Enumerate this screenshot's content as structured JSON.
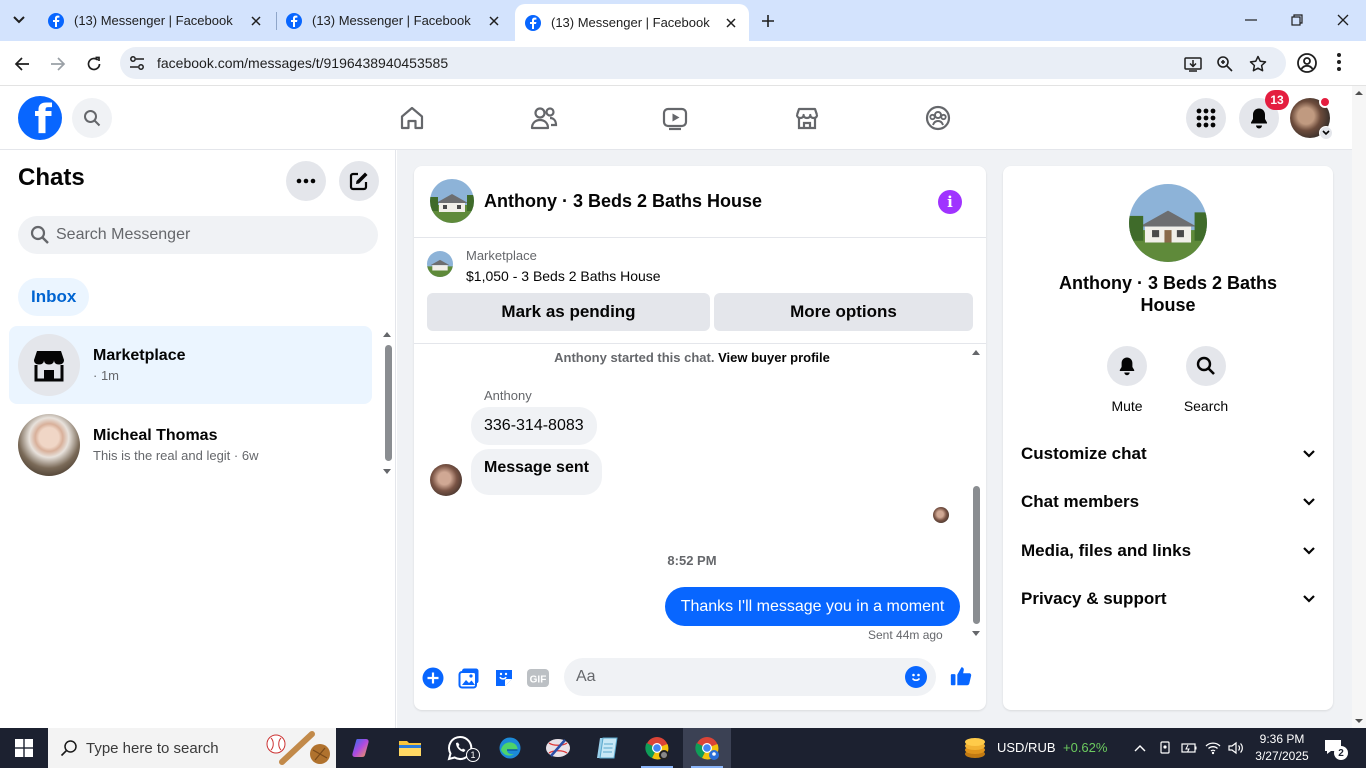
{
  "browser": {
    "tabs": [
      {
        "title": "(13) Messenger | Facebook"
      },
      {
        "title": "(13) Messenger | Facebook"
      },
      {
        "title": "(13) Messenger | Facebook"
      }
    ],
    "url": "facebook.com/messages/t/9196438940453585"
  },
  "fb_header": {
    "notification_count": "13",
    "brand_color": "#0866ff"
  },
  "left": {
    "title": "Chats",
    "search_placeholder": "Search Messenger",
    "inbox_label": "Inbox",
    "conversations": [
      {
        "name": "Marketplace",
        "preview": "· 1m"
      },
      {
        "name": "Micheal Thomas",
        "preview": "This is the real and legit · 6w"
      }
    ]
  },
  "conversation": {
    "title": "Anthony · 3 Beds 2 Baths House",
    "marketplace_label": "Marketplace",
    "listing": "$1,050 - 3 Beds 2 Baths House",
    "mark_pending": "Mark as pending",
    "more_options": "More options",
    "started_text": "Anthony started this chat.",
    "view_profile": "View buyer profile",
    "sender_name": "Anthony",
    "incoming": [
      "336-314-8083",
      "Message sent"
    ],
    "time_separator": "8:52 PM",
    "outgoing": "Thanks I'll message you in a moment",
    "sent_status": "Sent 44m ago",
    "composer_placeholder": "Aa",
    "gif_label": "GIF"
  },
  "info_panel": {
    "name": "Anthony · 3 Beds 2 Baths House",
    "actions": [
      "Mute",
      "Search"
    ],
    "sections": [
      "Customize chat",
      "Chat members",
      "Media, files and links",
      "Privacy & support"
    ]
  },
  "taskbar": {
    "search_placeholder": "Type here to search",
    "whatsapp_badge": "1",
    "ticker": "USD/RUB",
    "ticker_change": "+0.62%",
    "time": "9:36 PM",
    "date": "3/27/2025",
    "notifications": "2"
  }
}
